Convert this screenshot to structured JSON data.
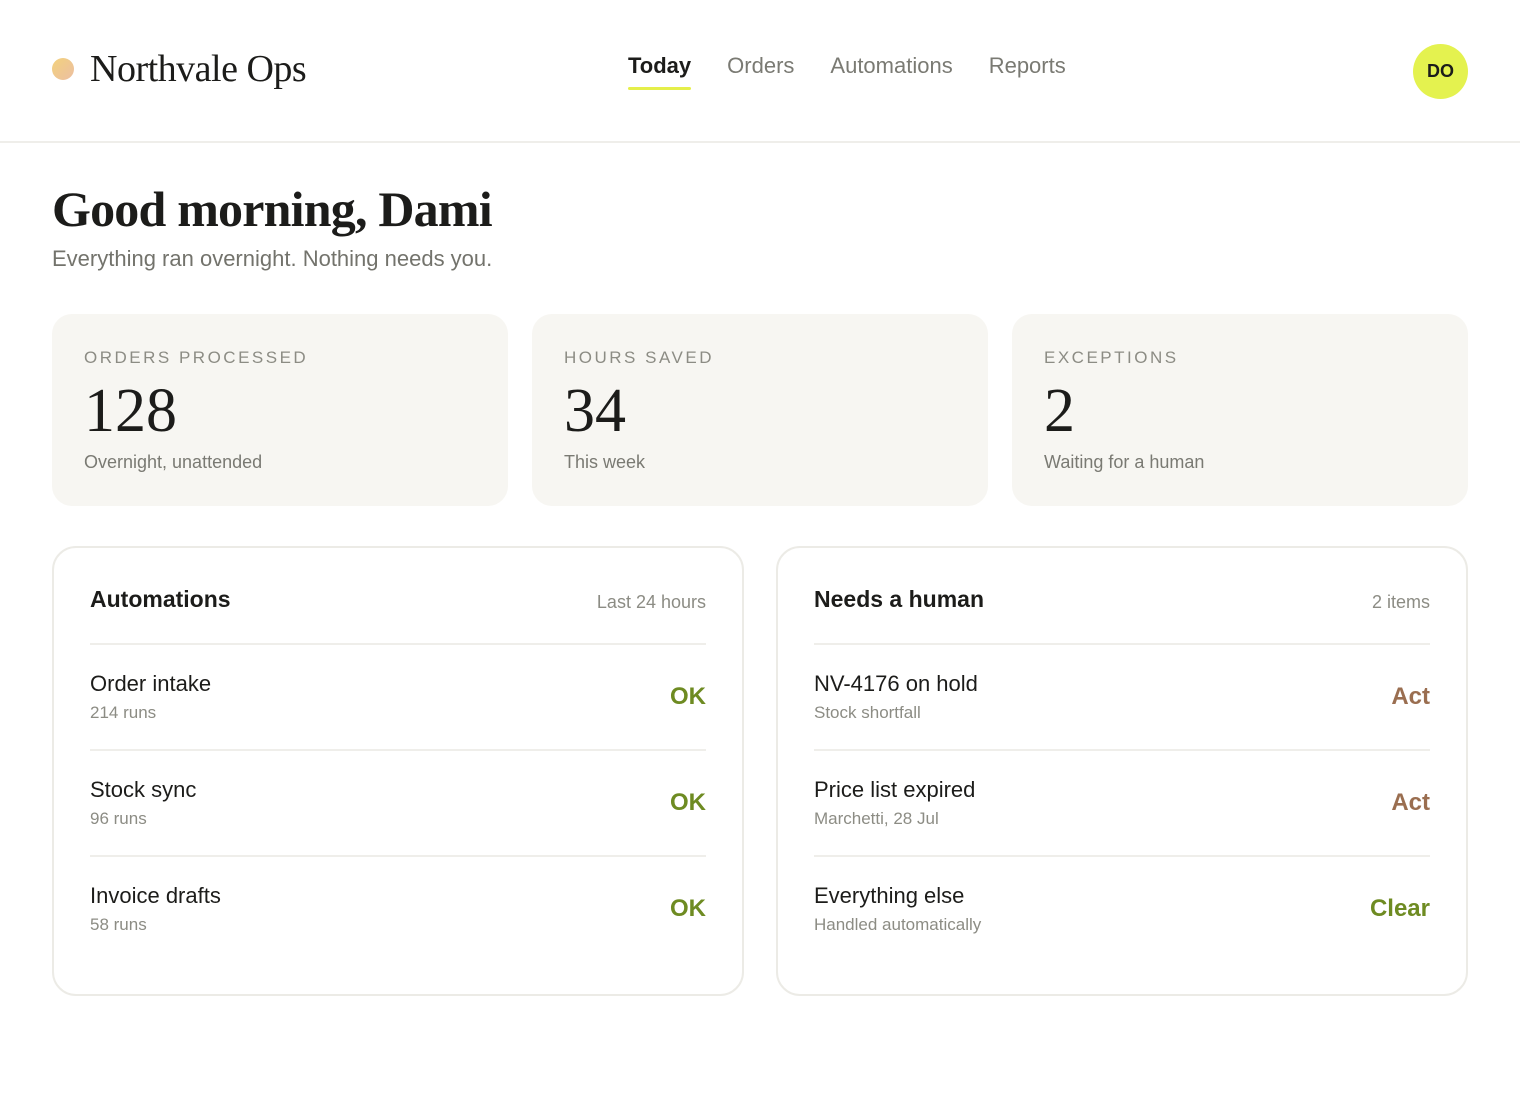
{
  "app": {
    "name": "Northvale Ops",
    "user_initials": "DO"
  },
  "nav": {
    "items": [
      {
        "label": "Today",
        "active": true
      },
      {
        "label": "Orders",
        "active": false
      },
      {
        "label": "Automations",
        "active": false
      },
      {
        "label": "Reports",
        "active": false
      }
    ]
  },
  "greeting": {
    "title": "Good morning, Dami",
    "subtitle": "Everything ran overnight. Nothing needs you."
  },
  "stats": [
    {
      "label": "ORDERS PROCESSED",
      "value": "128",
      "note": "Overnight, unattended"
    },
    {
      "label": "HOURS SAVED",
      "value": "34",
      "note": "This week"
    },
    {
      "label": "EXCEPTIONS",
      "value": "2",
      "note": "Waiting for a human"
    }
  ],
  "automations": {
    "title": "Automations",
    "meta": "Last 24 hours",
    "rows": [
      {
        "title": "Order intake",
        "sub": "214 runs",
        "status": "OK"
      },
      {
        "title": "Stock sync",
        "sub": "96 runs",
        "status": "OK"
      },
      {
        "title": "Invoice drafts",
        "sub": "58 runs",
        "status": "OK"
      }
    ]
  },
  "needs_human": {
    "title": "Needs a human",
    "meta": "2 items",
    "rows": [
      {
        "title": "NV-4176 on hold",
        "sub": "Stock shortfall",
        "status": "Act"
      },
      {
        "title": "Price list expired",
        "sub": "Marchetti, 28 Jul",
        "status": "Act"
      },
      {
        "title": "Everything else",
        "sub": "Handled automatically",
        "status": "Clear"
      }
    ]
  },
  "colors": {
    "accent": "#e4f24f",
    "ok": "#6e8b22",
    "act": "#9a6e50",
    "card_bg": "#f7f6f2"
  }
}
